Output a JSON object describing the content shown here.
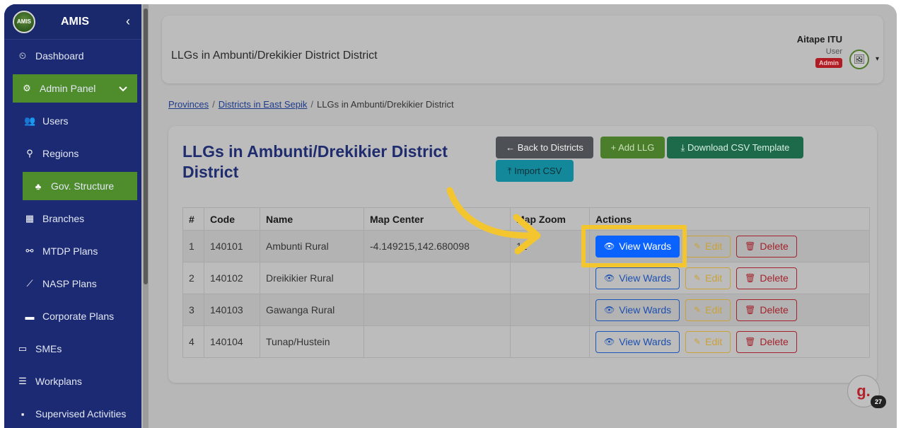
{
  "sidebar": {
    "brand": "AMIS",
    "logo_text": "AMIS",
    "toggle": "‹",
    "items": [
      {
        "label": "Dashboard",
        "icon": "⏲"
      },
      {
        "label": "Admin Panel",
        "icon": "⚙"
      },
      {
        "label": "Users",
        "icon": "👥"
      },
      {
        "label": "Regions",
        "icon": "⚲"
      },
      {
        "label": "Gov. Structure",
        "icon": "♣"
      },
      {
        "label": "Branches",
        "icon": "▦"
      },
      {
        "label": "MTDP Plans",
        "icon": "⚯"
      },
      {
        "label": "NASP Plans",
        "icon": "⟋"
      },
      {
        "label": "Corporate Plans",
        "icon": "▬"
      },
      {
        "label": "SMEs",
        "icon": "▭"
      },
      {
        "label": "Workplans",
        "icon": "☰"
      },
      {
        "label": "Supervised Activities",
        "icon": "▪"
      }
    ]
  },
  "topbar": {
    "title": "LLGs in Ambunti/Drekikier District District",
    "user_name": "Aitape ITU",
    "user_role": "User",
    "user_badge": "Admin",
    "avatar_icon": "🖼",
    "caret": "▾"
  },
  "breadcrumb": {
    "provinces": "Provinces",
    "districts": "Districts in East Sepik",
    "current": "LLGs in Ambunti/Drekikier District",
    "separator": "/"
  },
  "card": {
    "title": "LLGs in Ambunti/Drekikier District District",
    "back_button": "← Back to Districts",
    "add_button": "+ Add LLG",
    "csv_template_button": "⤓ Download CSV Template",
    "import_button": "⤒ Import CSV"
  },
  "table": {
    "headers": [
      "#",
      "Code",
      "Name",
      "Map Center",
      "Map Zoom",
      "Actions"
    ],
    "rows": [
      {
        "num": "1",
        "code": "140101",
        "name": "Ambunti Rural",
        "center": "-4.149215,142.680098",
        "zoom": "12"
      },
      {
        "num": "2",
        "code": "140102",
        "name": "Dreikikier Rural",
        "center": "",
        "zoom": ""
      },
      {
        "num": "3",
        "code": "140103",
        "name": "Gawanga Rural",
        "center": "",
        "zoom": ""
      },
      {
        "num": "4",
        "code": "140104",
        "name": "Tunap/Hustein",
        "center": "",
        "zoom": ""
      }
    ],
    "actions": {
      "view": "View Wards",
      "edit": "Edit",
      "delete": "Delete"
    }
  },
  "floating": {
    "logo": "g.",
    "count": "27"
  },
  "colors": {
    "sidebar": "#1b2a72",
    "active": "#4e8c2c",
    "highlight": "#f3c630",
    "primary": "#0a63ff"
  }
}
